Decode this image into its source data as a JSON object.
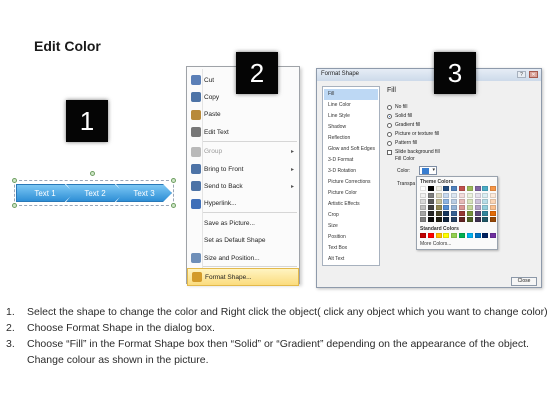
{
  "title": "Edit Color",
  "badges": [
    "1",
    "2",
    "3"
  ],
  "shape": {
    "segments": [
      "Text 1",
      "Text 2",
      "Text 3"
    ]
  },
  "context_menu": {
    "items": [
      {
        "label": "Cut",
        "icon": "scissors-icon",
        "icon_color": "#5b7fb7"
      },
      {
        "label": "Copy",
        "icon": "copy-icon",
        "icon_color": "#4d73a6"
      },
      {
        "label": "Paste",
        "icon": "paste-icon",
        "icon_color": "#b88a3a"
      },
      {
        "label": "Edit Text",
        "icon": "edit-text-icon",
        "icon_color": "#777777"
      },
      {
        "label": "Group",
        "icon": "group-icon",
        "icon_color": "#b9b9b9",
        "disabled": true,
        "submenu": true
      },
      {
        "label": "Bring to Front",
        "icon": "bring-to-front-icon",
        "icon_color": "#4d73a6",
        "submenu": true
      },
      {
        "label": "Send to Back",
        "icon": "send-to-back-icon",
        "icon_color": "#4d73a6",
        "submenu": true
      },
      {
        "label": "Hyperlink...",
        "icon": "hyperlink-icon",
        "icon_color": "#3f6fb8"
      },
      {
        "label": "Save as Picture..."
      },
      {
        "label": "Set as Default Shape"
      },
      {
        "label": "Size and Position...",
        "icon": "size-position-icon",
        "icon_color": "#6f8fb8"
      },
      {
        "label": "Format Shape...",
        "icon": "format-shape-icon",
        "icon_color": "#d39b2a",
        "highlighted": true
      }
    ]
  },
  "dialog": {
    "title": "Format Shape",
    "window_buttons": [
      "?",
      "✕"
    ],
    "nav_items": [
      "Fill",
      "Line Color",
      "Line Style",
      "Shadow",
      "Reflection",
      "Glow and Soft Edges",
      "3-D Format",
      "3-D Rotation",
      "Picture Corrections",
      "Picture Color",
      "Artistic Effects",
      "Crop",
      "Size",
      "Position",
      "Text Box",
      "Alt Text"
    ],
    "active_nav": "Fill",
    "fill_heading": "Fill",
    "fill_options": [
      "No fill",
      "Solid fill",
      "Gradient fill",
      "Picture or texture fill",
      "Pattern fill"
    ],
    "selected_fill": "Solid fill",
    "slide_background_label": "Slide background fill",
    "fill_color_label": "Fill Color",
    "color_label": "Color:",
    "transparency_label": "Transpa",
    "close_label": "Close"
  },
  "palette": {
    "theme_label": "Theme Colors",
    "standard_label": "Standard Colors",
    "more_label": "More Colors...",
    "theme_top": [
      "#ffffff",
      "#000000",
      "#eeece1",
      "#1f497d",
      "#4f81bd",
      "#c0504d",
      "#9bbb59",
      "#8064a2",
      "#4bacc6",
      "#f79646"
    ],
    "theme_tints": [
      [
        "#f2f2f2",
        "#7f7f7f",
        "#ddd9c3",
        "#c6d9f0",
        "#dbe5f1",
        "#f2dcdb",
        "#ebf1dd",
        "#e5e0ec",
        "#dbeef3",
        "#fdeada"
      ],
      [
        "#d8d8d8",
        "#595959",
        "#c4bd97",
        "#8db3e2",
        "#b8cce4",
        "#e5b9b7",
        "#d7e3bc",
        "#ccc1d9",
        "#b7dde8",
        "#fbd5b5"
      ],
      [
        "#bfbfbf",
        "#3f3f3f",
        "#938953",
        "#548dd4",
        "#95b3d7",
        "#d99694",
        "#c3d69b",
        "#b2a2c7",
        "#92cddc",
        "#fac08f"
      ],
      [
        "#a5a5a5",
        "#262626",
        "#494429",
        "#17365d",
        "#366092",
        "#953734",
        "#76923c",
        "#5f497a",
        "#31859b",
        "#e36c09"
      ],
      [
        "#7f7f7f",
        "#0c0c0c",
        "#1d1b10",
        "#0f243e",
        "#244061",
        "#632423",
        "#4f6128",
        "#3f3151",
        "#205867",
        "#974806"
      ]
    ],
    "standard": [
      "#c00000",
      "#ff0000",
      "#ffc000",
      "#ffff00",
      "#92d050",
      "#00b050",
      "#00b0f0",
      "#0070c0",
      "#002060",
      "#7030a0"
    ]
  },
  "instructions": [
    {
      "num": "1.",
      "text": "Select the shape to change the color and Right click the object( click any object which you want to change color)"
    },
    {
      "num": "2.",
      "text": "Choose Format Shape in the dialog box."
    },
    {
      "num": "3.",
      "text": "Choose “Fill” in the Format Shape box then “Solid” or “Gradient” depending on the appearance of the object. Change colour as shown in the picture."
    }
  ]
}
